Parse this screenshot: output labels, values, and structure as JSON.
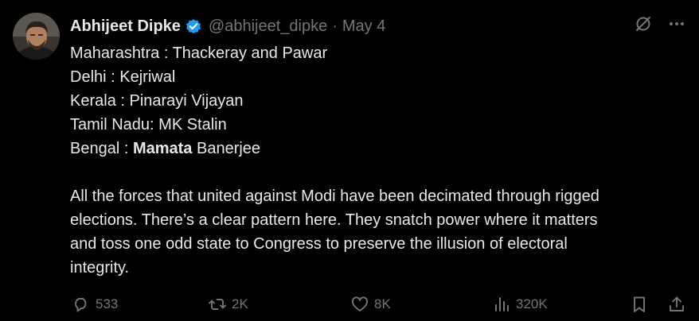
{
  "author": {
    "name": "Abhijeet Dipke",
    "handle": "@abhijeet_dipke",
    "separator": "·",
    "date": "May 4",
    "verified": true,
    "accent_color": "#1d9bf0"
  },
  "tweet": {
    "lines": [
      {
        "label": "Maharashtra : ",
        "name_pre": "",
        "name_bold": "",
        "name_post": "Thackeray and Pawar"
      },
      {
        "label": "Delhi : ",
        "name_pre": "",
        "name_bold": "",
        "name_post": "Kejriwal"
      },
      {
        "label": "Kerala : ",
        "name_pre": "",
        "name_bold": "",
        "name_post": "Pinarayi Vijayan"
      },
      {
        "label": "Tamil Nadu: ",
        "name_pre": "",
        "name_bold": "",
        "name_post": "MK Stalin"
      },
      {
        "label": "Bengal : ",
        "name_pre": "",
        "name_bold": "Mamata",
        "name_post": " Banerjee"
      }
    ],
    "paragraph_lines": [
      "All the forces that united against Modi have been decimated through rigged",
      "elections. There’s a clear pattern here. They snatch power where it matters",
      "and toss one odd state to Congress to preserve the illusion of electoral",
      "integrity."
    ]
  },
  "actions": {
    "replies": "533",
    "reposts": "2K",
    "likes": "8K",
    "views": "320K"
  },
  "icons": {
    "verified": "verified-badge-icon",
    "grok": "grok-icon",
    "more": "more-icon",
    "reply": "reply-icon",
    "repost": "repost-icon",
    "like": "heart-icon",
    "views": "views-icon",
    "bookmark": "bookmark-icon",
    "share": "share-icon"
  },
  "colors": {
    "background": "#000000",
    "text": "#e7e9ea",
    "muted": "#71767b"
  }
}
